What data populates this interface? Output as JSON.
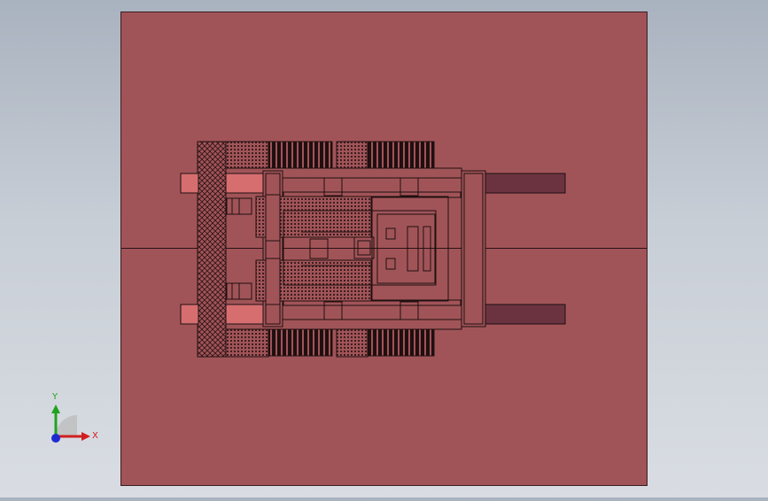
{
  "viewport": {
    "background": "#c4cad3",
    "plate_color": "#a15458",
    "plate_edge": "#3a1e20",
    "light_part_color": "#d66e70",
    "dark_part_color": "#6b3340",
    "line_color": "#1f0f10"
  },
  "triad": {
    "y_label": "Y",
    "x_label": "X",
    "y_color": "#1fa31f",
    "x_color": "#d11f1f",
    "z_color": "#1f2bd1",
    "icon": "coordinate-triad-icon"
  }
}
